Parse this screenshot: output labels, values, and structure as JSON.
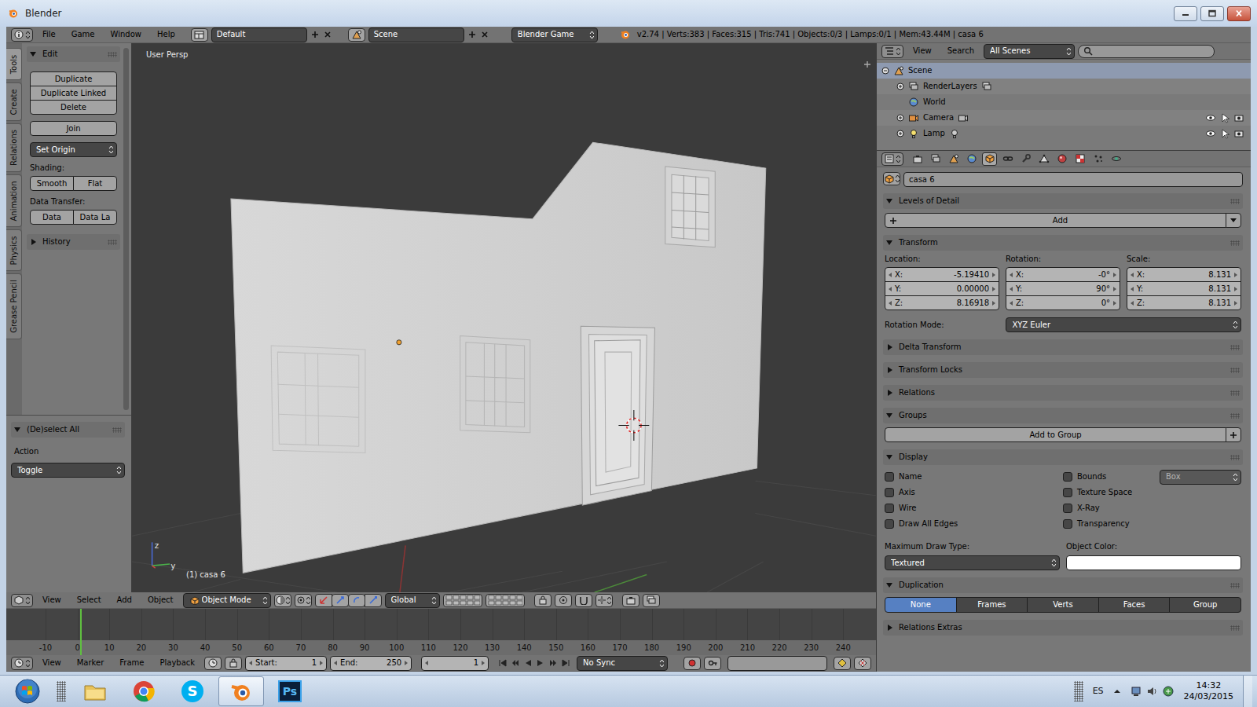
{
  "window": {
    "title": "Blender"
  },
  "info_header": {
    "menus": [
      "File",
      "Game",
      "Window",
      "Help"
    ],
    "layout": "Default",
    "scene": "Scene",
    "engine": "Blender Game",
    "stats": "v2.74 | Verts:383 | Faces:315 | Tris:741 | Objects:0/3 | Lamps:0/1 | Mem:43.44M | casa 6"
  },
  "tool_shelf": {
    "tabs": [
      {
        "label": "Tools",
        "selected": true
      },
      {
        "label": "Create",
        "selected": false
      },
      {
        "label": "Relations",
        "selected": false
      },
      {
        "label": "Animation",
        "selected": false
      },
      {
        "label": "Physics",
        "selected": false
      },
      {
        "label": "Grease Pencil",
        "selected": false
      }
    ],
    "edit": {
      "title": "Edit",
      "expanded": true,
      "buttons": [
        "Duplicate",
        "Duplicate Linked",
        "Delete"
      ],
      "join": "Join",
      "set_origin": "Set Origin",
      "shading_label": "Shading:",
      "shading": [
        "Smooth",
        "Flat"
      ],
      "transfer_label": "Data Transfer:",
      "transfer": [
        "Data",
        "Data La"
      ]
    },
    "history": {
      "title": "History",
      "expanded": false
    }
  },
  "operator": {
    "title": "(De)select All",
    "expanded": true,
    "action_label": "Action",
    "action": "Toggle"
  },
  "viewport": {
    "view": "User Persp",
    "object": "(1) casa 6",
    "gizmo": [
      "z",
      "y"
    ],
    "menus": [
      "View",
      "Select",
      "Add",
      "Object"
    ],
    "mode": "Object Mode",
    "orientation": "Global"
  },
  "timeline": {
    "ticks": [
      "-10",
      "0",
      "10",
      "20",
      "30",
      "40",
      "50",
      "60",
      "70",
      "80",
      "90",
      "100",
      "110",
      "120",
      "130",
      "140",
      "150",
      "160",
      "170",
      "180",
      "190",
      "200",
      "210",
      "220",
      "230",
      "240"
    ],
    "playhead_level": 0.085,
    "menus": [
      "View",
      "Marker",
      "Frame",
      "Playback"
    ],
    "start_label": "Start:",
    "start": "1",
    "end_label": "End:",
    "end": "250",
    "frame": "1",
    "sync": "No Sync"
  },
  "outliner": {
    "menus": [
      "View",
      "Search"
    ],
    "filter": "All Scenes",
    "items": [
      {
        "label": "Scene",
        "kind": "scene",
        "highlighted": true,
        "expanded": true,
        "children": [
          {
            "label": "RenderLayers",
            "kind": "renderlayers",
            "highlighted": false,
            "expanded": false
          },
          {
            "label": "World",
            "kind": "world",
            "highlighted": false
          },
          {
            "label": "Camera",
            "kind": "camera",
            "highlighted": false,
            "expanded": false
          },
          {
            "label": "Lamp",
            "kind": "lamp",
            "highlighted": false,
            "expanded": false
          }
        ]
      }
    ]
  },
  "properties": {
    "tabs": [
      {
        "selected": false
      },
      {
        "selected": false
      },
      {
        "selected": false
      },
      {
        "selected": false
      },
      {
        "selected": true
      },
      {
        "selected": false
      },
      {
        "selected": false
      },
      {
        "selected": false
      },
      {
        "selected": false
      },
      {
        "selected": false
      },
      {
        "selected": false
      },
      {
        "selected": false
      }
    ],
    "object_name": "casa 6",
    "panels": [
      {
        "kind": "lod",
        "title": "Levels of Detail",
        "expanded": true,
        "button": "Add"
      },
      {
        "kind": "transform",
        "title": "Transform",
        "expanded": true,
        "columns": [
          {
            "label": "Location:",
            "fields": [
              {
                "axis": "X:",
                "value": "-5.19410"
              },
              {
                "axis": "Y:",
                "value": "0.00000"
              },
              {
                "axis": "Z:",
                "value": "8.16918"
              }
            ]
          },
          {
            "label": "Rotation:",
            "fields": [
              {
                "axis": "X:",
                "value": "-0°"
              },
              {
                "axis": "Y:",
                "value": "90°"
              },
              {
                "axis": "Z:",
                "value": "0°"
              }
            ]
          },
          {
            "label": "Scale:",
            "fields": [
              {
                "axis": "X:",
                "value": "8.131"
              },
              {
                "axis": "Y:",
                "value": "8.131"
              },
              {
                "axis": "Z:",
                "value": "8.131"
              }
            ]
          }
        ],
        "mode_label": "Rotation Mode:",
        "mode": "XYZ Euler"
      },
      {
        "kind": "collapsed",
        "title": "Delta Transform",
        "expanded": false
      },
      {
        "kind": "collapsed",
        "title": "Transform Locks",
        "expanded": false
      },
      {
        "kind": "collapsed",
        "title": "Relations",
        "expanded": false
      },
      {
        "kind": "groups",
        "title": "Groups",
        "expanded": true,
        "button": "Add to Group"
      },
      {
        "kind": "display",
        "title": "Display",
        "expanded": true,
        "checks": [
          {
            "label": "Name",
            "checked": false
          },
          {
            "label": "Bounds",
            "checked": false,
            "option": "Box",
            "option_disabled": true
          },
          {
            "label": "Axis",
            "checked": false
          },
          {
            "label": "Texture Space",
            "checked": false
          },
          {
            "label": "Wire",
            "checked": false
          },
          {
            "label": "X-Ray",
            "checked": false
          },
          {
            "label": "Draw All Edges",
            "checked": false
          },
          {
            "label": "Transparency",
            "checked": false
          }
        ],
        "draw_label": "Maximum Draw Type:",
        "draw_type": "Textured",
        "color_label": "Object Color:",
        "object_color": "#ffffff"
      },
      {
        "kind": "duplication",
        "title": "Duplication",
        "expanded": true,
        "options": [
          {
            "label": "None",
            "selected": true
          },
          {
            "label": "Frames",
            "selected": false
          },
          {
            "label": "Verts",
            "selected": false
          },
          {
            "label": "Faces",
            "selected": false
          },
          {
            "label": "Group",
            "selected": false
          }
        ]
      },
      {
        "kind": "collapsed",
        "title": "Relations Extras",
        "expanded": false
      }
    ]
  },
  "taskbar": {
    "apps": [
      {
        "kind": "explorer",
        "active": false
      },
      {
        "kind": "chrome",
        "active": false
      },
      {
        "kind": "skype",
        "active": false,
        "label": "S"
      },
      {
        "kind": "blender",
        "active": true
      },
      {
        "kind": "photoshop",
        "active": false,
        "label": "Ps"
      }
    ],
    "language": "ES",
    "time": "14:32",
    "date": "24/03/2015"
  }
}
